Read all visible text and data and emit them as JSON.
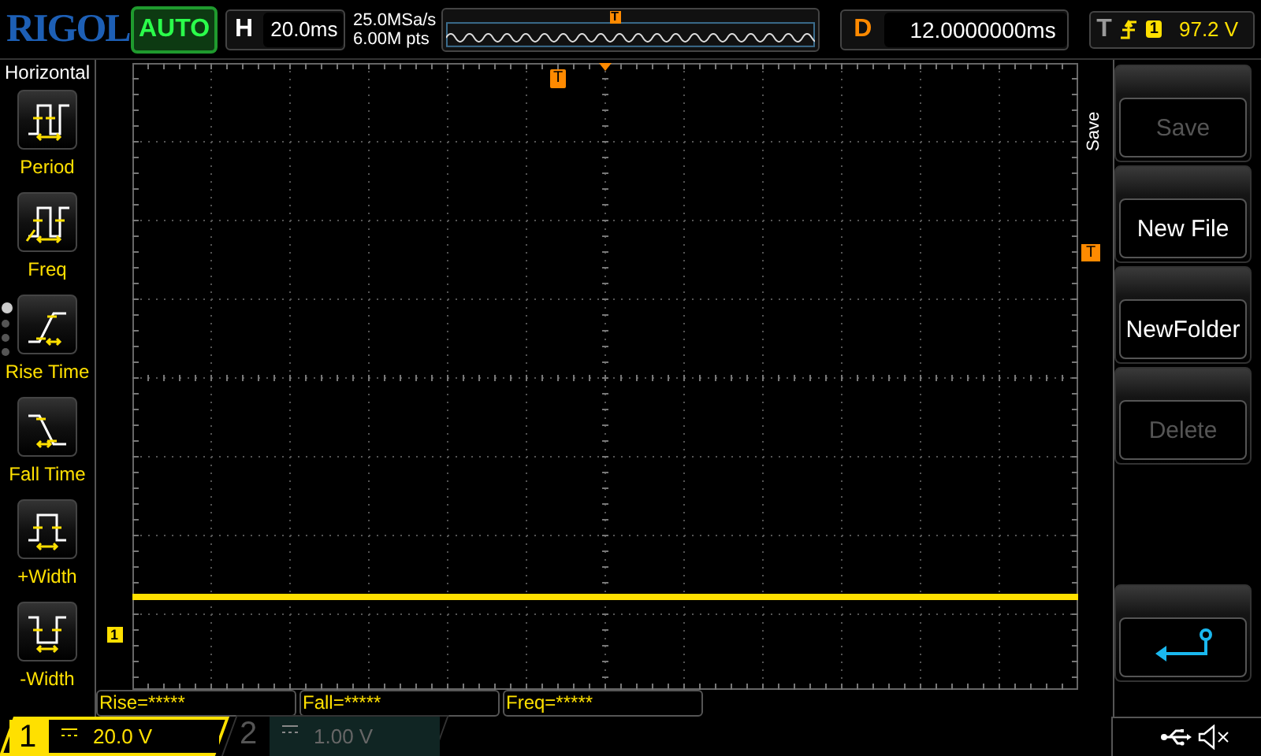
{
  "brand": {
    "logo": "RIGOL"
  },
  "run_state": {
    "label": "AUTO"
  },
  "timebase": {
    "label": "H",
    "value": "20.0ms"
  },
  "acquisition": {
    "sample_rate": "25.0MSa/s",
    "memory_depth": "6.00M pts",
    "strip_marker": "T"
  },
  "delay": {
    "label": "D",
    "value": "12.0000000ms"
  },
  "trigger": {
    "label": "T",
    "channel": "1",
    "level": "97.2 V"
  },
  "left_menu": {
    "title": "Horizontal",
    "items": [
      {
        "label": "Period",
        "kind": "period"
      },
      {
        "label": "Freq",
        "kind": "freq"
      },
      {
        "label": "Rise Time",
        "kind": "rise"
      },
      {
        "label": "Fall Time",
        "kind": "fall"
      },
      {
        "label": "+Width",
        "kind": "pwidth"
      },
      {
        "label": "-Width",
        "kind": "nwidth"
      }
    ],
    "pages": [
      {
        "selected": true
      },
      {
        "selected": false
      },
      {
        "selected": false
      },
      {
        "selected": false
      }
    ]
  },
  "waveform": {
    "channel_marker": "1",
    "trigger_position_marker": "T",
    "trigger_level_marker": "T"
  },
  "right_menu": {
    "title": "Save",
    "items": [
      {
        "kind": "text",
        "label": "Save",
        "disabled": true
      },
      {
        "kind": "text",
        "label": "New File",
        "disabled": false
      },
      {
        "kind": "text",
        "label": "NewFolder",
        "disabled": false
      },
      {
        "kind": "text",
        "label": "Delete",
        "disabled": true
      },
      {
        "kind": "back"
      }
    ]
  },
  "measurements": [
    "Rise=*****",
    "Fall=*****",
    "Freq=*****"
  ],
  "channels": [
    {
      "number": "1",
      "scale": "20.0 V",
      "selected": true
    },
    {
      "number": "2",
      "scale": "1.00 V",
      "selected": false
    }
  ]
}
